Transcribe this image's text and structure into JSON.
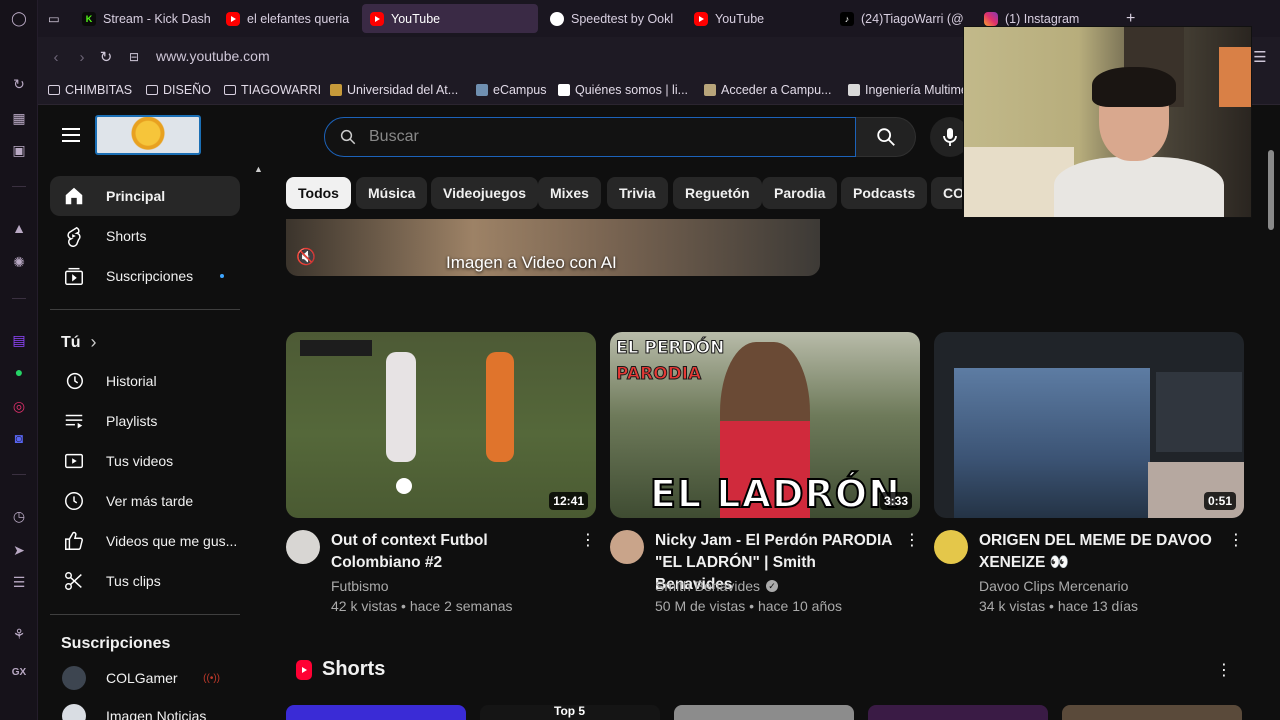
{
  "browser": {
    "tabs": [
      {
        "label": "Stream - Kick Dash",
        "favicon": "kick",
        "favicon_text": "K"
      },
      {
        "label": "el elefantes queria",
        "favicon": "youtube"
      },
      {
        "label": "YouTube",
        "favicon": "youtube",
        "active": true
      },
      {
        "label": "Speedtest by Ookl",
        "favicon": "github"
      },
      {
        "label": "YouTube",
        "favicon": "youtube"
      },
      {
        "label": "(24)TiagoWarri (@",
        "favicon": "tiktok",
        "favicon_text": "♪"
      },
      {
        "label": "(1) Instagram",
        "favicon": "instagram"
      }
    ],
    "new_tab_label": "+",
    "url": "www.youtube.com",
    "bookmarks": [
      {
        "label": "CHIMBITAS",
        "type": "folder"
      },
      {
        "label": "DISEÑO",
        "type": "folder"
      },
      {
        "label": "TIAGOWARRI",
        "type": "folder"
      },
      {
        "label": "Universidad del At...",
        "type": "site"
      },
      {
        "label": "eCampus",
        "type": "site"
      },
      {
        "label": "Quiénes somos | li...",
        "type": "site"
      },
      {
        "label": "Acceder a Campu...",
        "type": "site"
      },
      {
        "label": "Ingeniería Multime",
        "type": "site"
      }
    ],
    "accent_color": "#3a2a45"
  },
  "header": {
    "search_placeholder": "Buscar"
  },
  "sidebar": {
    "main": [
      {
        "label": "Principal",
        "icon": "home-icon",
        "active": true
      },
      {
        "label": "Shorts",
        "icon": "shorts-icon"
      },
      {
        "label": "Suscripciones",
        "icon": "subscriptions-icon",
        "badge": "new-dot"
      }
    ],
    "you_heading": "Tú",
    "you_chevron": "›",
    "you": [
      {
        "label": "Historial",
        "icon": "history-icon"
      },
      {
        "label": "Playlists",
        "icon": "playlists-icon"
      },
      {
        "label": "Tus videos",
        "icon": "your-videos-icon"
      },
      {
        "label": "Ver más tarde",
        "icon": "watch-later-icon"
      },
      {
        "label": "Videos que me gus...",
        "icon": "liked-icon"
      },
      {
        "label": "Tus clips",
        "icon": "clips-icon"
      }
    ],
    "subs_heading": "Suscripciones",
    "subscriptions": [
      {
        "label": "COLGamer",
        "live": true
      },
      {
        "label": "Imagen Noticias"
      }
    ]
  },
  "chips": [
    "Todos",
    "Música",
    "Videojuegos",
    "Mixes",
    "Trivia",
    "Reguetón",
    "Parodia",
    "Podcasts",
    "COL"
  ],
  "ad": {
    "text": "Imagen a Video con AI"
  },
  "videos": [
    {
      "title": "Out of context Futbol Colombiano #2",
      "channel": "Futbismo",
      "stats": "42 k vistas • hace 2 semanas",
      "duration": "12:41",
      "verified": false
    },
    {
      "title": "Nicky Jam - El Perdón PARODIA \"EL LADRÓN\" | Smith Benavides",
      "channel": "Smith Benavides",
      "stats": "50 M de vistas • hace 10 años",
      "duration": "3:33",
      "verified": true,
      "thumb_text_top": "EL PERDÓN",
      "thumb_text_mid": "PARODIA",
      "thumb_text_big": "EL LADRÓN"
    },
    {
      "title": "ORIGEN DEL MEME DE DAVOO XENEIZE 👀",
      "channel": "Davoo Clips Mercenario",
      "stats": "34 k vistas • hace 13 días",
      "duration": "0:51",
      "verified": false
    }
  ],
  "shorts": {
    "title": "Shorts",
    "peek_label": "Top 5"
  },
  "colors": {
    "youtube_red": "#ff0000",
    "chip_active": "#f1f1f1",
    "link_blue": "#3ea6ff"
  }
}
